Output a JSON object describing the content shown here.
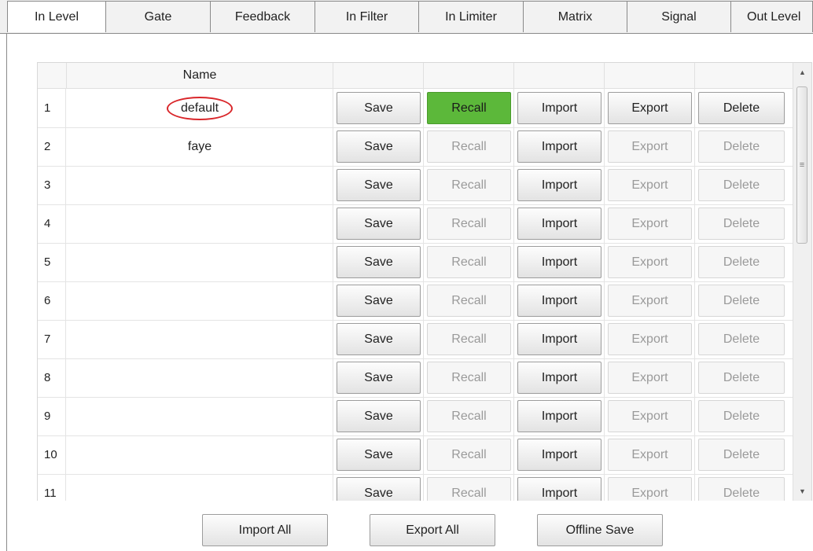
{
  "tabs": [
    {
      "label": "In Level"
    },
    {
      "label": "Gate"
    },
    {
      "label": "Feedback"
    },
    {
      "label": "In Filter"
    },
    {
      "label": "In Limiter"
    },
    {
      "label": "Matrix"
    },
    {
      "label": "Signal"
    },
    {
      "label": "Out Level"
    }
  ],
  "grid": {
    "header": {
      "name": "Name"
    },
    "rows": [
      {
        "num": "1",
        "name": "default",
        "save": "Save",
        "recall": "Recall",
        "import": "Import",
        "export": "Export",
        "delete": "Delete"
      },
      {
        "num": "2",
        "name": "faye",
        "save": "Save",
        "recall": "Recall",
        "import": "Import",
        "export": "Export",
        "delete": "Delete"
      },
      {
        "num": "3",
        "name": "",
        "save": "Save",
        "recall": "Recall",
        "import": "Import",
        "export": "Export",
        "delete": "Delete"
      },
      {
        "num": "4",
        "name": "",
        "save": "Save",
        "recall": "Recall",
        "import": "Import",
        "export": "Export",
        "delete": "Delete"
      },
      {
        "num": "5",
        "name": "",
        "save": "Save",
        "recall": "Recall",
        "import": "Import",
        "export": "Export",
        "delete": "Delete"
      },
      {
        "num": "6",
        "name": "",
        "save": "Save",
        "recall": "Recall",
        "import": "Import",
        "export": "Export",
        "delete": "Delete"
      },
      {
        "num": "7",
        "name": "",
        "save": "Save",
        "recall": "Recall",
        "import": "Import",
        "export": "Export",
        "delete": "Delete"
      },
      {
        "num": "8",
        "name": "",
        "save": "Save",
        "recall": "Recall",
        "import": "Import",
        "export": "Export",
        "delete": "Delete"
      },
      {
        "num": "9",
        "name": "",
        "save": "Save",
        "recall": "Recall",
        "import": "Import",
        "export": "Export",
        "delete": "Delete"
      },
      {
        "num": "10",
        "name": "",
        "save": "Save",
        "recall": "Recall",
        "import": "Import",
        "export": "Export",
        "delete": "Delete"
      },
      {
        "num": "11",
        "name": "",
        "save": "Save",
        "recall": "Recall",
        "import": "Import",
        "export": "Export",
        "delete": "Delete"
      }
    ]
  },
  "scrollbar": {
    "up_icon": "triangle-up",
    "down_icon": "triangle-down",
    "grip_icon": "grip-lines"
  },
  "bottom": {
    "import_all": "Import All",
    "export_all": "Export All",
    "offline_save": "Offline Save"
  },
  "colors": {
    "recall_active": "#5cb83a",
    "highlight_circle": "#d9262a"
  }
}
